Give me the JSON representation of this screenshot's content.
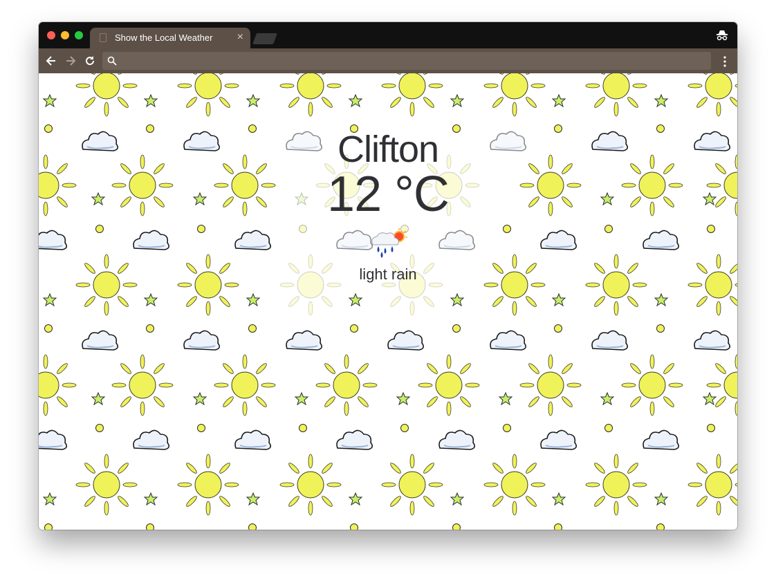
{
  "browser": {
    "tab_title": "Show the Local Weather",
    "tab_close": "×",
    "icons": [
      "back-icon",
      "forward-icon",
      "reload-icon",
      "search-icon",
      "menu-icon",
      "incognito-icon"
    ]
  },
  "weather": {
    "city": "Clifton",
    "temperature": "12 °C",
    "condition": "light rain",
    "icon": "light-rain-sun-icon"
  },
  "colors": {
    "titlebar": "#111111",
    "toolbar": "#5d5047",
    "sun_fill": "#f0f25a",
    "text": "#2f3033"
  }
}
